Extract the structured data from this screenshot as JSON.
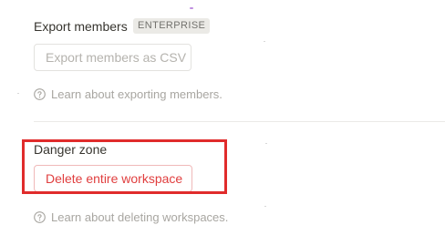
{
  "export_members": {
    "title": "Export members",
    "badge": "ENTERPRISE",
    "button_label": "Export members as CSV",
    "help_text": "Learn about exporting members."
  },
  "danger_zone": {
    "title": "Danger zone",
    "button_label": "Delete entire workspace",
    "help_text": "Learn about deleting workspaces."
  },
  "colors": {
    "text": "#37352f",
    "muted": "#a8a6a1",
    "danger": "#e03e3e",
    "highlight_border": "#e02b2b",
    "badge_bg": "#ebeae6"
  },
  "icons": {
    "help": "question-circle-icon"
  }
}
